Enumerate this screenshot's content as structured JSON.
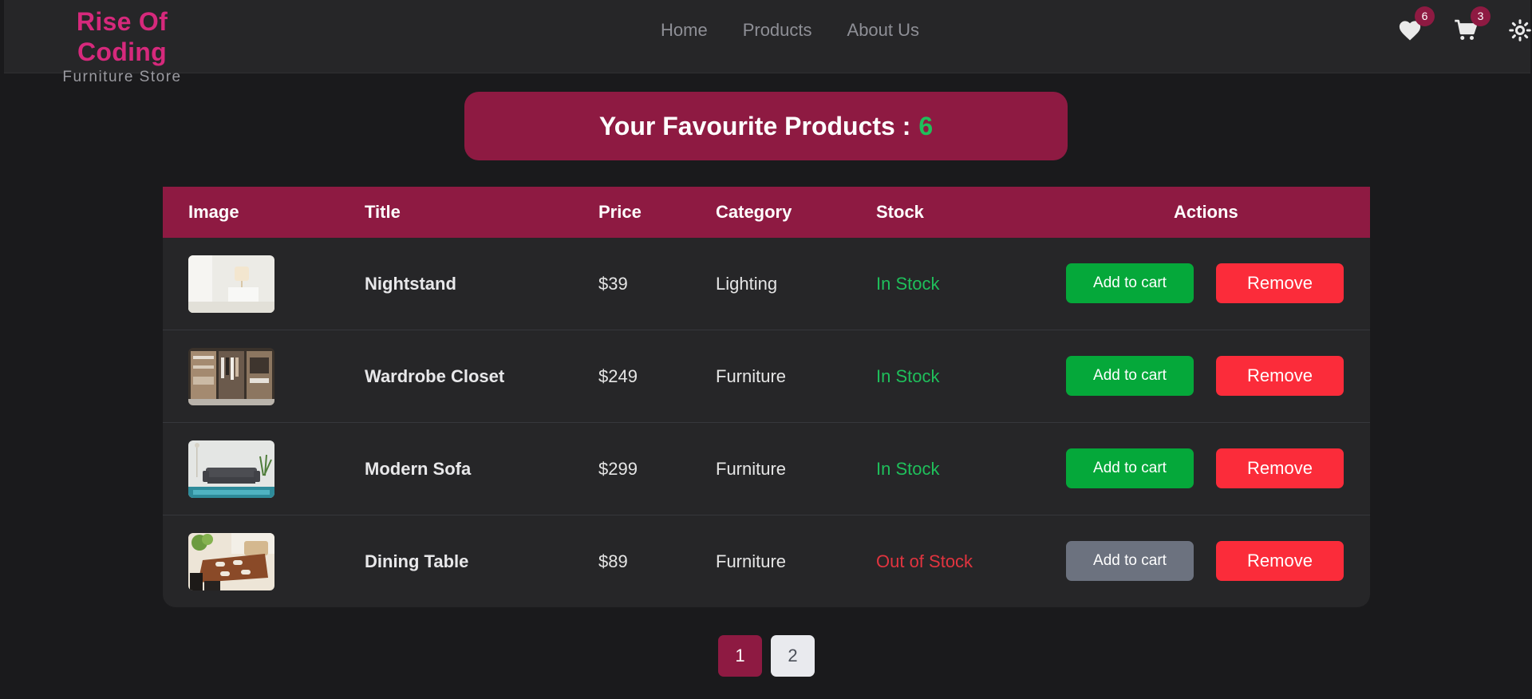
{
  "brand": {
    "title": "Rise Of Coding",
    "subtitle": "Furniture Store"
  },
  "nav": {
    "links": [
      "Home",
      "Products",
      "About Us"
    ]
  },
  "header_icons": {
    "favorites_icon": "heart-icon",
    "favorites_count": "6",
    "cart_icon": "cart-icon",
    "cart_count": "3",
    "theme_icon": "sun-icon"
  },
  "banner": {
    "label": "Your Favourite Products :",
    "count": "6"
  },
  "table": {
    "headers": [
      "Image",
      "Title",
      "Price",
      "Category",
      "Stock",
      "Actions"
    ],
    "rows": [
      {
        "title": "Nightstand",
        "price": "$39",
        "category": "Lighting",
        "stock": "In Stock",
        "in_stock": true,
        "add_label": "Add to cart",
        "remove_label": "Remove"
      },
      {
        "title": "Wardrobe Closet",
        "price": "$249",
        "category": "Furniture",
        "stock": "In Stock",
        "in_stock": true,
        "add_label": "Add to cart",
        "remove_label": "Remove"
      },
      {
        "title": "Modern Sofa",
        "price": "$299",
        "category": "Furniture",
        "stock": "In Stock",
        "in_stock": true,
        "add_label": "Add to cart",
        "remove_label": "Remove"
      },
      {
        "title": "Dining Table",
        "price": "$89",
        "category": "Furniture",
        "stock": "Out of Stock",
        "in_stock": false,
        "add_label": "Add to cart",
        "remove_label": "Remove"
      }
    ]
  },
  "pagination": {
    "pages": [
      "1",
      "2"
    ],
    "current": "1"
  },
  "colors": {
    "accent": "#8e1a42",
    "brand": "#d6297c",
    "in_stock": "#1fbf5b",
    "out_of_stock": "#e1343f",
    "add_button": "#05a83a",
    "remove_button": "#fb2c3a",
    "disabled_button": "#6c727f"
  }
}
